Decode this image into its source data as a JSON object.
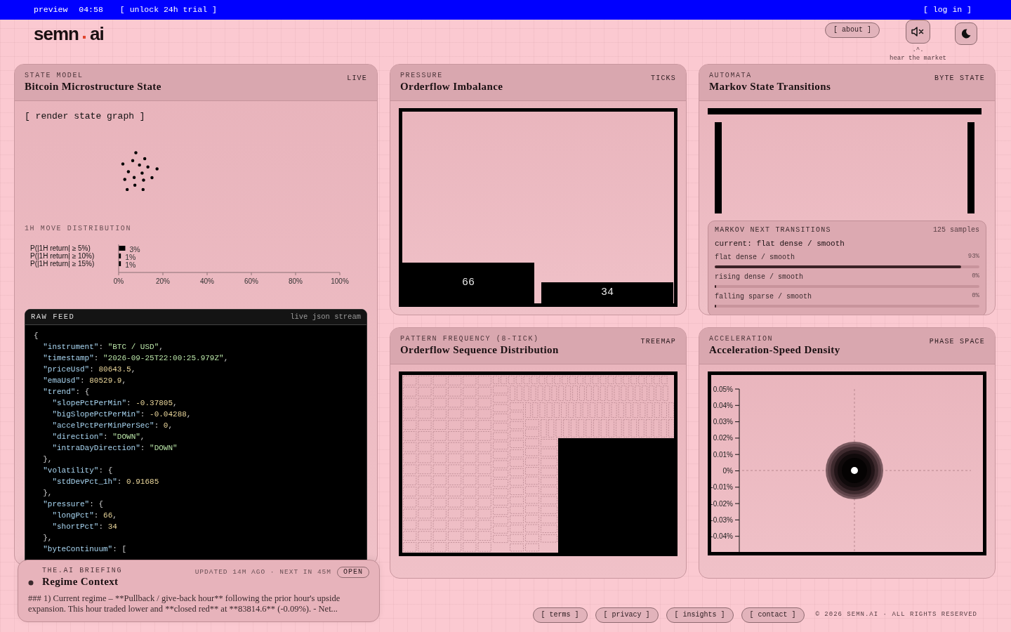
{
  "top_bar": {
    "mode": "preview",
    "timer": "04:58",
    "trial_link": "[ unlock 24h trial ]",
    "login_link": "[ log in ]"
  },
  "header": {
    "logo": {
      "left": "semn",
      "right": "ai"
    },
    "about_button": "[ about ]",
    "sound": {
      "muted": true,
      "face": ".^.",
      "caption": "hear the market"
    }
  },
  "state_model": {
    "eyebrow": "STATE MODEL",
    "title": "Bitcoin Microstructure State",
    "badge": "LIVE",
    "render_button": "[ render state graph ]",
    "distribution": {
      "heading": "1H MOVE DISTRIBUTION",
      "chart_data": {
        "type": "bar",
        "orientation": "horizontal",
        "categories": [
          "P(|1H return| ≥ 5%)",
          "P(|1H return| ≥ 10%)",
          "P(|1H return| ≥ 15%)"
        ],
        "values": [
          3,
          1,
          1
        ],
        "value_labels": [
          "3%",
          "1%",
          "1%"
        ],
        "xlim": [
          0,
          100
        ],
        "xticks": [
          {
            "value": 0,
            "label": "0%"
          },
          {
            "value": 20,
            "label": "20%"
          },
          {
            "value": 40,
            "label": "40%"
          },
          {
            "value": 60,
            "label": "60%"
          },
          {
            "value": 80,
            "label": "80%"
          },
          {
            "value": 100,
            "label": "100%"
          }
        ]
      }
    },
    "raw_feed": {
      "title": "RAW FEED",
      "subtitle": "live json stream",
      "lines": [
        "{",
        "  \"instrument\": \"BTC / USD\",",
        "  \"timestamp\": \"2026-09-25T22:00:25.979Z\",",
        "  \"priceUsd\": 80643.5,",
        "  \"emaUsd\": 80529.9,",
        "  \"trend\": {",
        "    \"slopePctPerMin\": -0.37805,",
        "    \"bigSlopePctPerMin\": -0.04288,",
        "    \"accelPctPerMinPerSec\": 0,",
        "    \"direction\": \"DOWN\",",
        "    \"intraDayDirection\": \"DOWN\"",
        "  },",
        "  \"volatility\": {",
        "    \"stdDevPct_1h\": 0.91685",
        "  },",
        "  \"pressure\": {",
        "    \"longPct\": 66,",
        "    \"shortPct\": 34",
        "  },",
        "  \"byteContinuum\": ["
      ]
    }
  },
  "pressure": {
    "eyebrow": "PRESSURE",
    "title": "Orderflow Imbalance",
    "badge": "TICKS",
    "segments": [
      {
        "value": "66"
      },
      {
        "value": "34"
      }
    ]
  },
  "automata": {
    "eyebrow": "AUTOMATA",
    "title": "Markov State Transitions",
    "badge": "BYTE STATE",
    "transitions": {
      "heading": "MARKOV NEXT TRANSITIONS",
      "samples": "125 samples",
      "current": "current: flat dense / smooth",
      "rows": [
        {
          "label": "flat dense / smooth",
          "reading": "93%",
          "level": 0.93
        },
        {
          "label": "rising dense / smooth",
          "reading": "0%",
          "level": 0
        },
        {
          "label": "falling sparse / smooth",
          "reading": "0%",
          "level": 0
        }
      ]
    }
  },
  "pattern": {
    "eyebrow": "PATTERN FREQUENCY (8-TICK)",
    "title": "Orderflow Sequence Distribution",
    "badge": "TREEMAP"
  },
  "acceleration": {
    "eyebrow": "ACCELERATION",
    "title": "Acceleration-Speed Density",
    "badge": "PHASE SPACE",
    "y_ticks": [
      "0.05%",
      "0.04%",
      "0.03%",
      "0.02%",
      "0.01%",
      "0%",
      "-0.01%",
      "-0.02%",
      "-0.03%",
      "-0.04%"
    ]
  },
  "briefing": {
    "eyebrow": "THE.AI BRIEFING",
    "title": "Regime Context",
    "status": "UPDATED 14M AGO · NEXT IN 45M",
    "open_button": "OPEN",
    "summary": "### 1) Current regime – **Pullback / give-back hour** following the prior hour's upside expansion. This hour traded lower and **closed red** at **83814.6** (-0.09%). - Net..."
  },
  "footer": {
    "links": [
      "[ terms ]",
      "[ privacy ]",
      "[ insights ]",
      "[ contact ]"
    ],
    "copyright": "© 2026 SEMN.AI · ALL RIGHTS RESERVED"
  }
}
